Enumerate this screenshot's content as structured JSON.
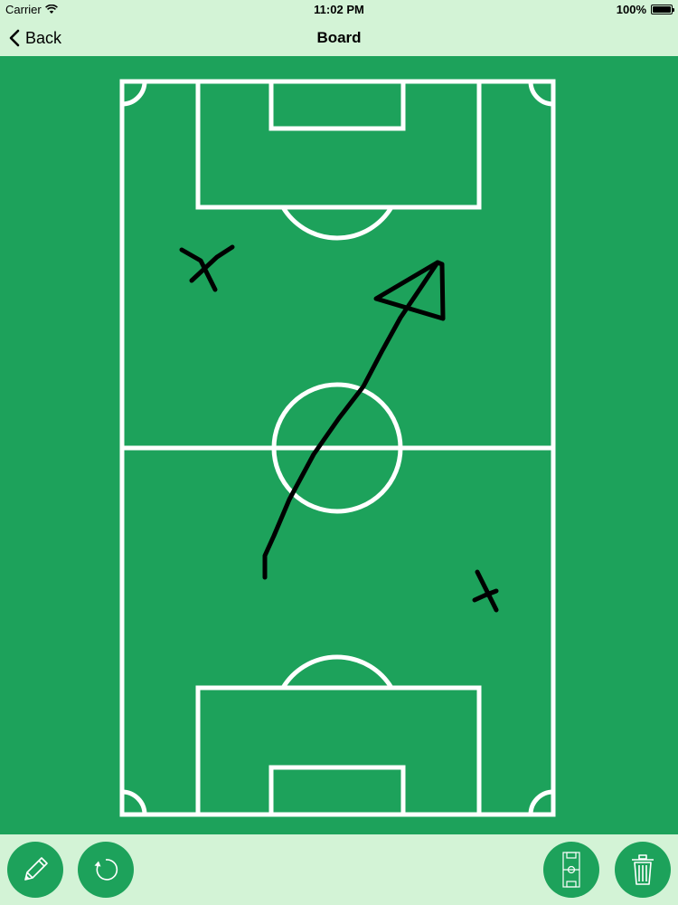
{
  "status_bar": {
    "carrier": "Carrier",
    "time": "11:02 PM",
    "battery": "100%",
    "wifi_icon": "wifi-icon",
    "battery_icon": "battery-icon"
  },
  "nav": {
    "back_label": "Back",
    "title": "Board",
    "back_icon": "chevron-left-icon"
  },
  "colors": {
    "bar_background": "#d3f3d6",
    "pitch_green": "#1da25b",
    "line_white": "#ffffff",
    "drawing": "#000000"
  },
  "board": {
    "field_lines_icon": "soccer-pitch",
    "drawings": [
      "x-marker",
      "arrow-path",
      "x-marker"
    ]
  },
  "toolbar": {
    "pencil_icon": "pencil-icon",
    "undo_icon": "undo-icon",
    "field_icon": "soccer-field-icon",
    "trash_icon": "trash-icon"
  }
}
